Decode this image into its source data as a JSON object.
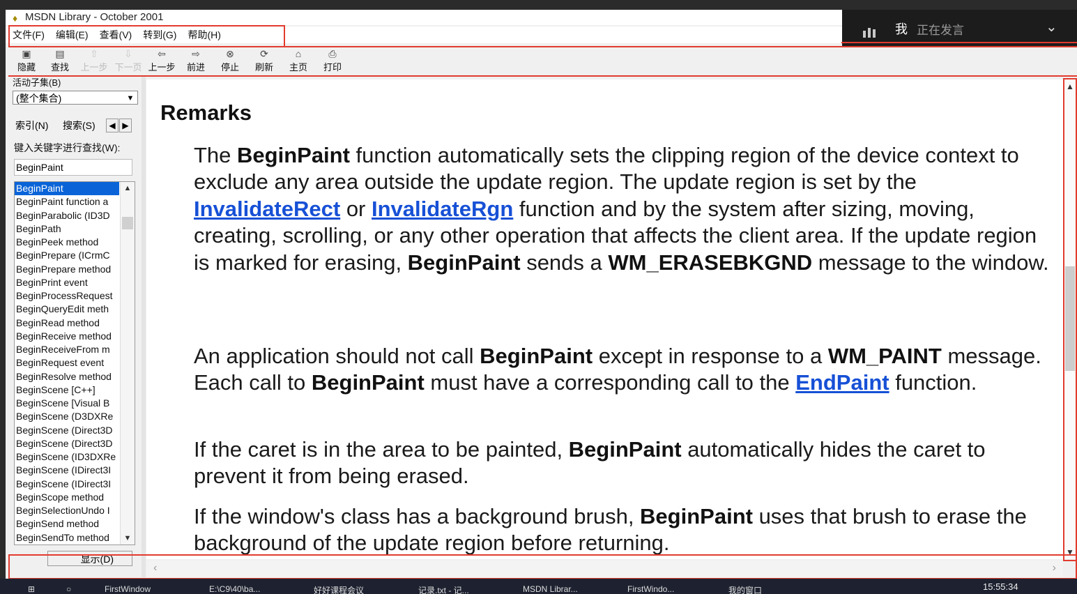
{
  "window": {
    "title": "MSDN Library - October 2001"
  },
  "menu": [
    "文件(F)",
    "编辑(E)",
    "查看(V)",
    "转到(G)",
    "帮助(H)"
  ],
  "toolbar": [
    {
      "label": "隐藏",
      "icon": "hide-icon",
      "enabled": true
    },
    {
      "label": "查找",
      "icon": "locate-icon",
      "enabled": true
    },
    {
      "label": "上一步",
      "icon": "up-arrow-icon",
      "enabled": false
    },
    {
      "label": "下一页",
      "icon": "down-arrow-icon",
      "enabled": false
    },
    {
      "label": "上一步",
      "icon": "back-icon",
      "enabled": true
    },
    {
      "label": "前进",
      "icon": "forward-icon",
      "enabled": true
    },
    {
      "label": "停止",
      "icon": "stop-icon",
      "enabled": true
    },
    {
      "label": "刷新",
      "icon": "refresh-icon",
      "enabled": true
    },
    {
      "label": "主页",
      "icon": "home-icon",
      "enabled": true
    },
    {
      "label": "打印",
      "icon": "print-icon",
      "enabled": true
    }
  ],
  "speaker": {
    "name": "我",
    "status": "正在发言"
  },
  "nav": {
    "subset_label": "活动子集(B)",
    "subset_value": "(整个集合)",
    "tab_index": "索引(N)",
    "tab_search": "搜索(S)",
    "keyword_label": "键入关键字进行查找(W):",
    "keyword_value": "BeginPaint",
    "index_items": [
      "BeginPaint",
      "BeginPaint function a",
      "BeginParabolic (ID3D",
      "BeginPath",
      "BeginPeek method",
      "BeginPrepare (ICrmC",
      "BeginPrepare method",
      "BeginPrint event",
      "BeginProcessRequest",
      "BeginQueryEdit meth",
      "BeginRead method",
      "BeginReceive method",
      "BeginReceiveFrom m",
      "BeginRequest event",
      "BeginResolve method",
      "BeginScene [C++]",
      "BeginScene [Visual B",
      "BeginScene (D3DXRe",
      "BeginScene (Direct3D",
      "BeginScene (Direct3D",
      "BeginScene (ID3DXRe",
      "BeginScene (IDirect3I",
      "BeginScene (IDirect3I",
      "BeginScope method",
      "BeginSelectionUndo I",
      "BeginSend method",
      "BeginSendTo method"
    ],
    "selected_index": 0,
    "show_button": "显示(D)"
  },
  "content": {
    "heading": "Remarks",
    "p1": {
      "t1": "The ",
      "b1": "BeginPaint",
      "t2": " function automatically sets the clipping region of the device context to exclude any area outside the update region. The update region is set by the ",
      "l1": "InvalidateRect",
      "t3": " or ",
      "l2": "InvalidateRgn",
      "t4": " function and by the system after sizing, moving, creating, scrolling, or any other operation that affects the client area. If the update region is marked for erasing, ",
      "b2": "BeginPaint",
      "t5": " sends a ",
      "b3": "WM_ERASEBKGND",
      "t6": " message to the window."
    },
    "p2": {
      "t1": "An application should not call ",
      "b1": "BeginPaint",
      "t2": " except in response to a ",
      "b2": "WM_PAINT",
      "t3": " message. Each call to ",
      "b3": "BeginPaint",
      "t4": " must have a corresponding call to the ",
      "l1": "EndPaint",
      "t5": " function."
    },
    "p3": {
      "t1": "If the caret is in the area to be painted, ",
      "b1": "BeginPaint",
      "t2": " automatically hides the caret to prevent it from being erased."
    },
    "p4": {
      "t1": "If the window's class has a background brush, ",
      "b1": "BeginPaint",
      "t2": " uses that brush to erase the background of the update region before returning."
    }
  },
  "taskbar": {
    "clock": "15:55:34",
    "items": [
      "FirstWindow",
      "E:\\C9\\40\\ba...",
      "好好课程会议",
      "记录.txt - 记...",
      "MSDN Librar...",
      "FirstWindo...",
      "我的窗口"
    ]
  },
  "colors": {
    "highlight": "#e23b2e",
    "selection": "#0a64d8",
    "link": "#1650d6"
  }
}
